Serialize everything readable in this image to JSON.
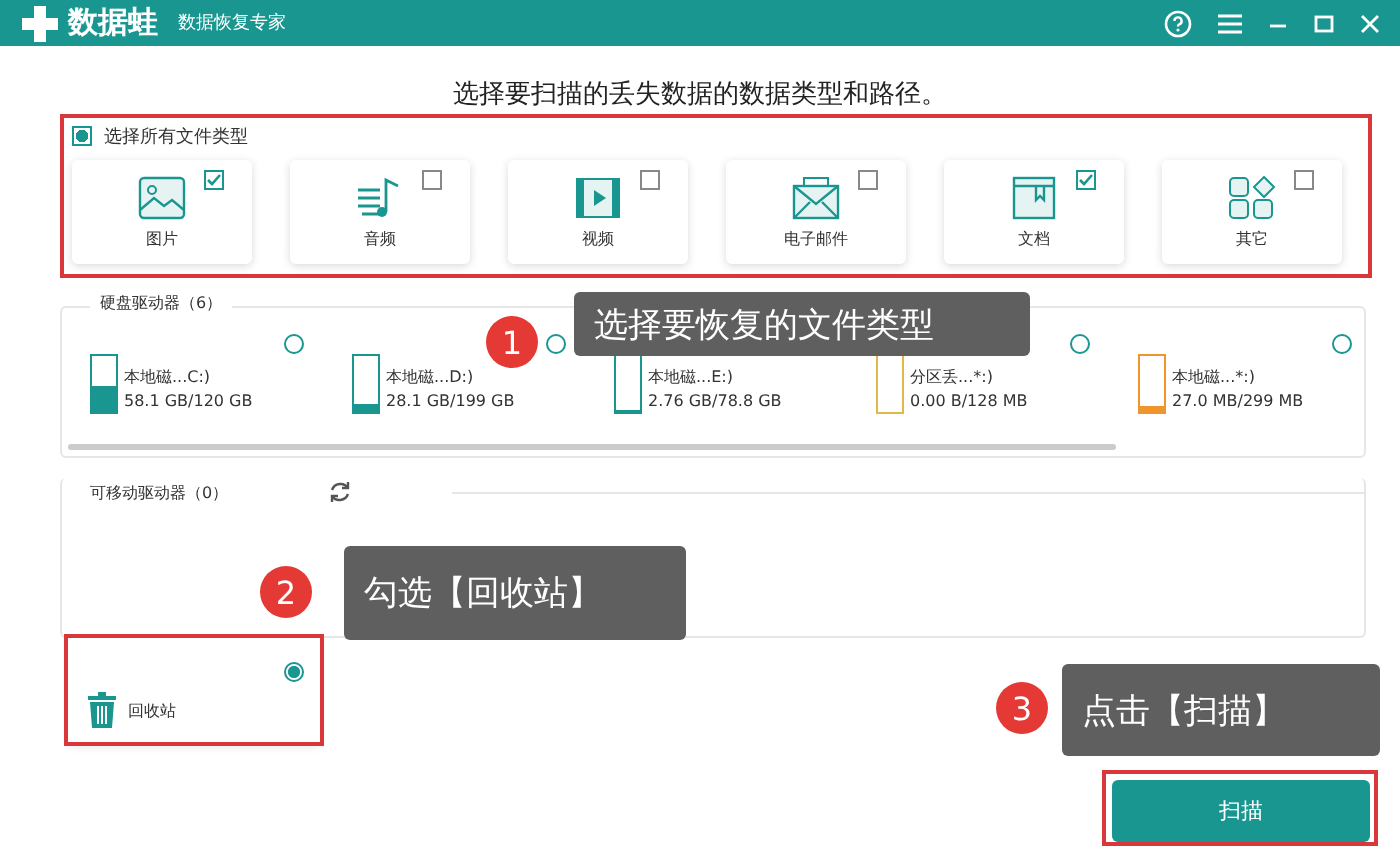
{
  "title_bar": {
    "app_name": "数据蛙",
    "subtitle": "数据恢复专家"
  },
  "heading": "选择要扫描的丢失数据的数据类型和路径。",
  "file_types": {
    "select_all": {
      "label": "选择所有文件类型",
      "checked": true
    },
    "items": [
      {
        "label": "图片",
        "kind": "image",
        "checked": true
      },
      {
        "label": "音频",
        "kind": "audio",
        "checked": false
      },
      {
        "label": "视频",
        "kind": "video",
        "checked": false
      },
      {
        "label": "电子邮件",
        "kind": "email",
        "checked": false
      },
      {
        "label": "文档",
        "kind": "document",
        "checked": true
      },
      {
        "label": "其它",
        "kind": "other",
        "checked": false
      }
    ]
  },
  "hard_drives": {
    "label": "硬盘驱动器（6）",
    "drives": [
      {
        "name": "本地磁...C:)",
        "usage": "58.1 GB/120 GB",
        "level": 0.48,
        "color": "#1a9690",
        "selected": false
      },
      {
        "name": "本地磁...D:)",
        "usage": "28.1 GB/199 GB",
        "level": 0.14,
        "color": "#1a9690",
        "selected": false
      },
      {
        "name": "本地磁...E:)",
        "usage": "2.76 GB/78.8 GB",
        "level": 0.04,
        "color": "#1a9690"
      },
      {
        "name": "分区丢...*:)",
        "usage": "0.00  B/128 MB",
        "level": 0,
        "color": "#e0b84a",
        "selected": false
      },
      {
        "name": "本地磁...*:)",
        "usage": "27.0 MB/299 MB",
        "level": 0.09,
        "color": "#f0952a",
        "selected": false
      }
    ]
  },
  "removable_drives": {
    "label": "可移动驱动器（0）"
  },
  "recycle_bin": {
    "label": "回收站",
    "selected": true
  },
  "scan_button": "扫描",
  "callouts": [
    {
      "number": "1",
      "text": "选择要恢复的文件类型"
    },
    {
      "number": "2",
      "text": "勾选【回收站】"
    },
    {
      "number": "3",
      "text": "点击【扫描】"
    }
  ]
}
